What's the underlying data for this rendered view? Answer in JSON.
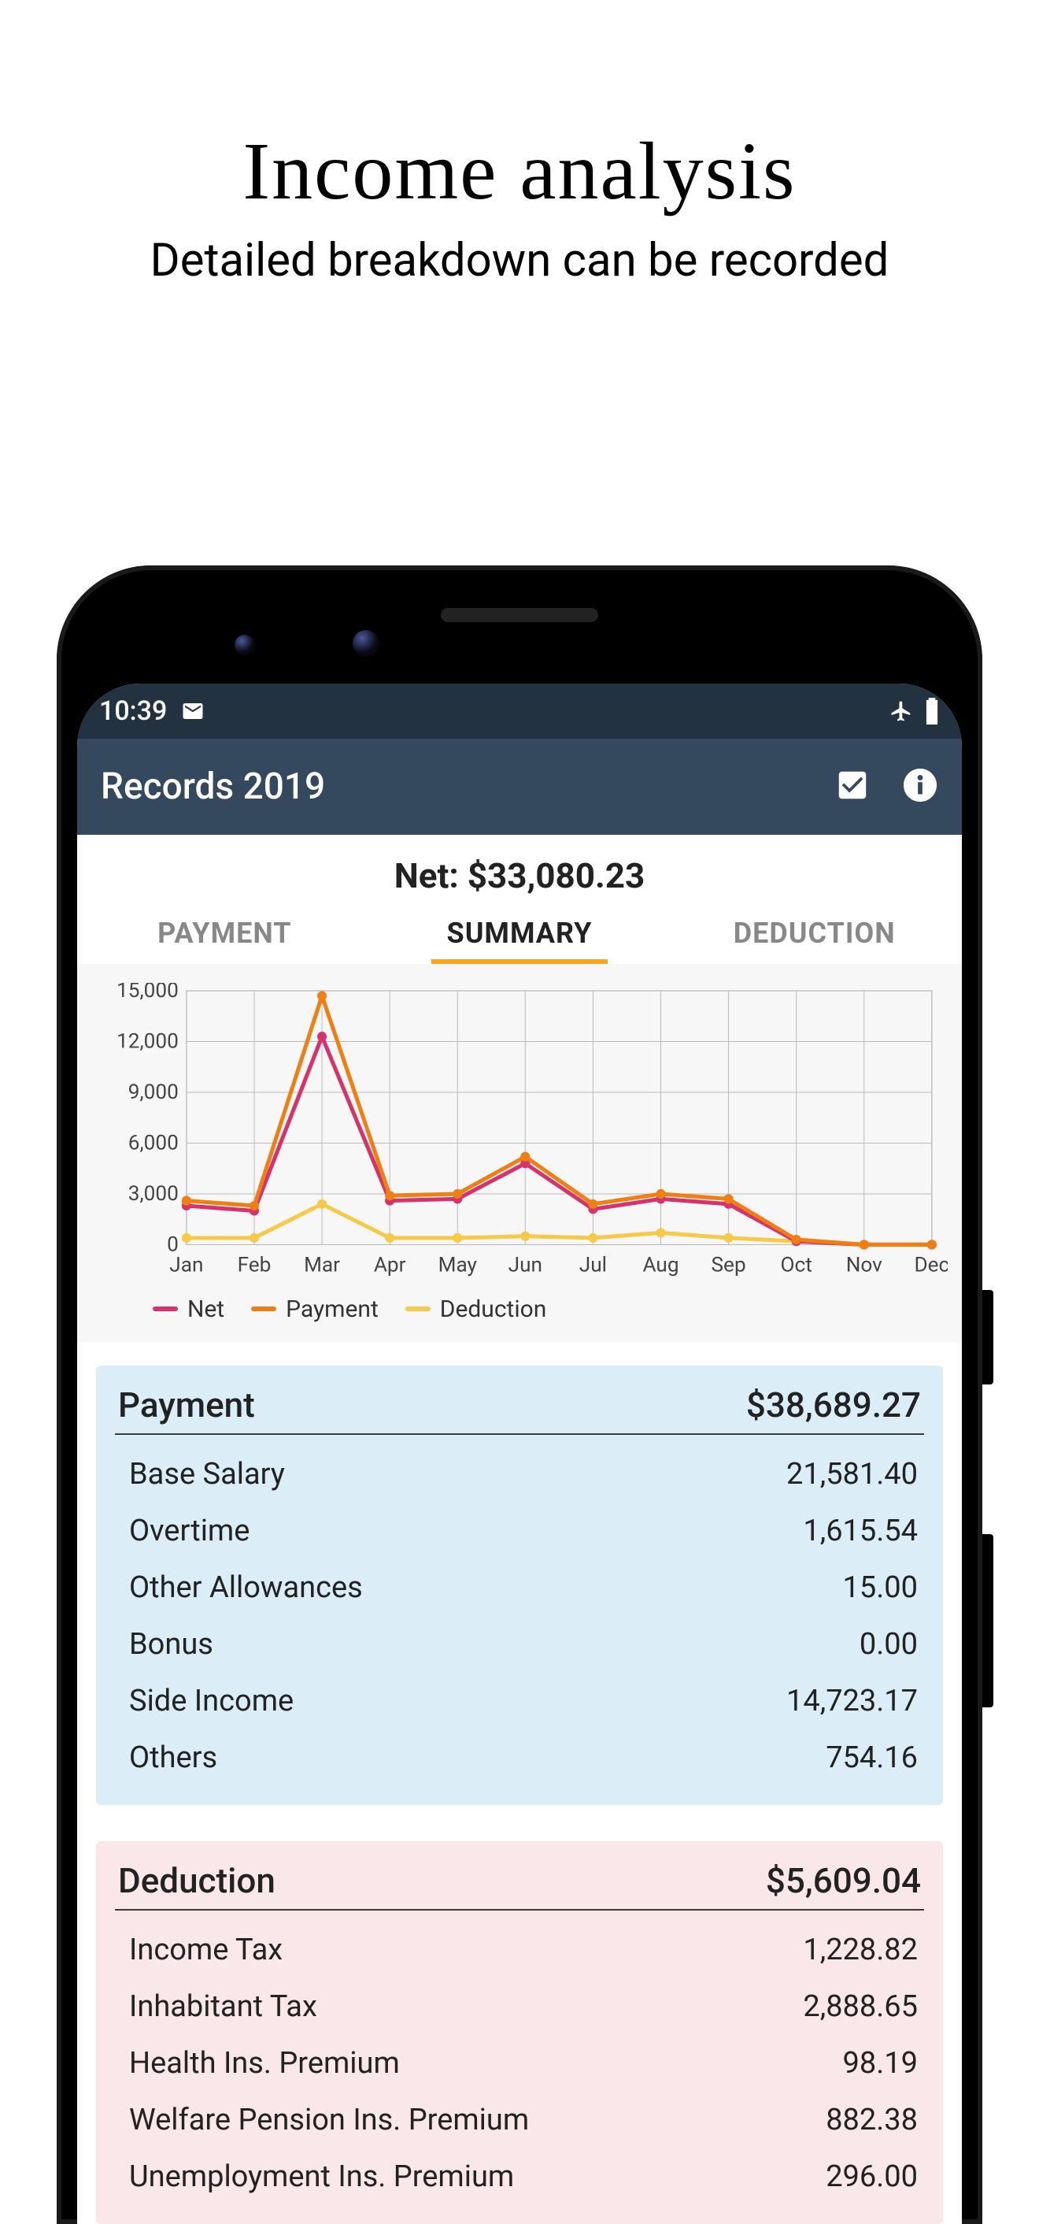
{
  "promo": {
    "title": "Income analysis",
    "subtitle": "Detailed breakdown can be recorded"
  },
  "statusbar": {
    "time": "10:39"
  },
  "appbar": {
    "title": "Records 2019"
  },
  "summary": {
    "net_label": "Net: $33,080.23"
  },
  "tabs": {
    "payment": "PAYMENT",
    "summary": "SUMMARY",
    "deduction": "DEDUCTION"
  },
  "legend": {
    "net": "Net",
    "payment": "Payment",
    "deduction": "Deduction"
  },
  "colors": {
    "net": "#d6326b",
    "payment": "#f07f13",
    "deduction": "#f7c948"
  },
  "payment_card": {
    "title": "Payment",
    "total": "$38,689.27",
    "items": [
      {
        "label": "Base Salary",
        "value": "21,581.40"
      },
      {
        "label": "Overtime",
        "value": "1,615.54"
      },
      {
        "label": "Other Allowances",
        "value": "15.00"
      },
      {
        "label": "Bonus",
        "value": "0.00"
      },
      {
        "label": "Side Income",
        "value": "14,723.17"
      },
      {
        "label": "Others",
        "value": "754.16"
      }
    ]
  },
  "deduction_card": {
    "title": "Deduction",
    "total": "$5,609.04",
    "items": [
      {
        "label": "Income Tax",
        "value": "1,228.82"
      },
      {
        "label": "Inhabitant Tax",
        "value": "2,888.65"
      },
      {
        "label": "Health Ins. Premium",
        "value": "98.19"
      },
      {
        "label": "Welfare Pension Ins. Premium",
        "value": "882.38"
      },
      {
        "label": "Unemployment Ins. Premium",
        "value": "296.00"
      }
    ]
  },
  "chart_data": {
    "type": "line",
    "categories": [
      "Jan",
      "Feb",
      "Mar",
      "Apr",
      "May",
      "Jun",
      "Jul",
      "Aug",
      "Sep",
      "Oct",
      "Nov",
      "Dec"
    ],
    "ylim": [
      0,
      15000
    ],
    "yticks": [
      0,
      3000,
      6000,
      9000,
      12000,
      15000
    ],
    "ytick_labels": [
      "0",
      "3,000",
      "6,000",
      "9,000",
      "12,000",
      "15,000"
    ],
    "xlabel": "",
    "ylabel": "",
    "series": [
      {
        "name": "Net",
        "color": "#d6326b",
        "values": [
          2300,
          2000,
          12300,
          2600,
          2700,
          4800,
          2100,
          2700,
          2400,
          200,
          0,
          0
        ]
      },
      {
        "name": "Payment",
        "color": "#f07f13",
        "values": [
          2600,
          2300,
          14700,
          2900,
          3000,
          5200,
          2400,
          3000,
          2700,
          300,
          0,
          0
        ]
      },
      {
        "name": "Deduction",
        "color": "#f7c948",
        "values": [
          400,
          400,
          2400,
          400,
          400,
          500,
          400,
          700,
          400,
          200,
          0,
          0
        ]
      }
    ]
  }
}
